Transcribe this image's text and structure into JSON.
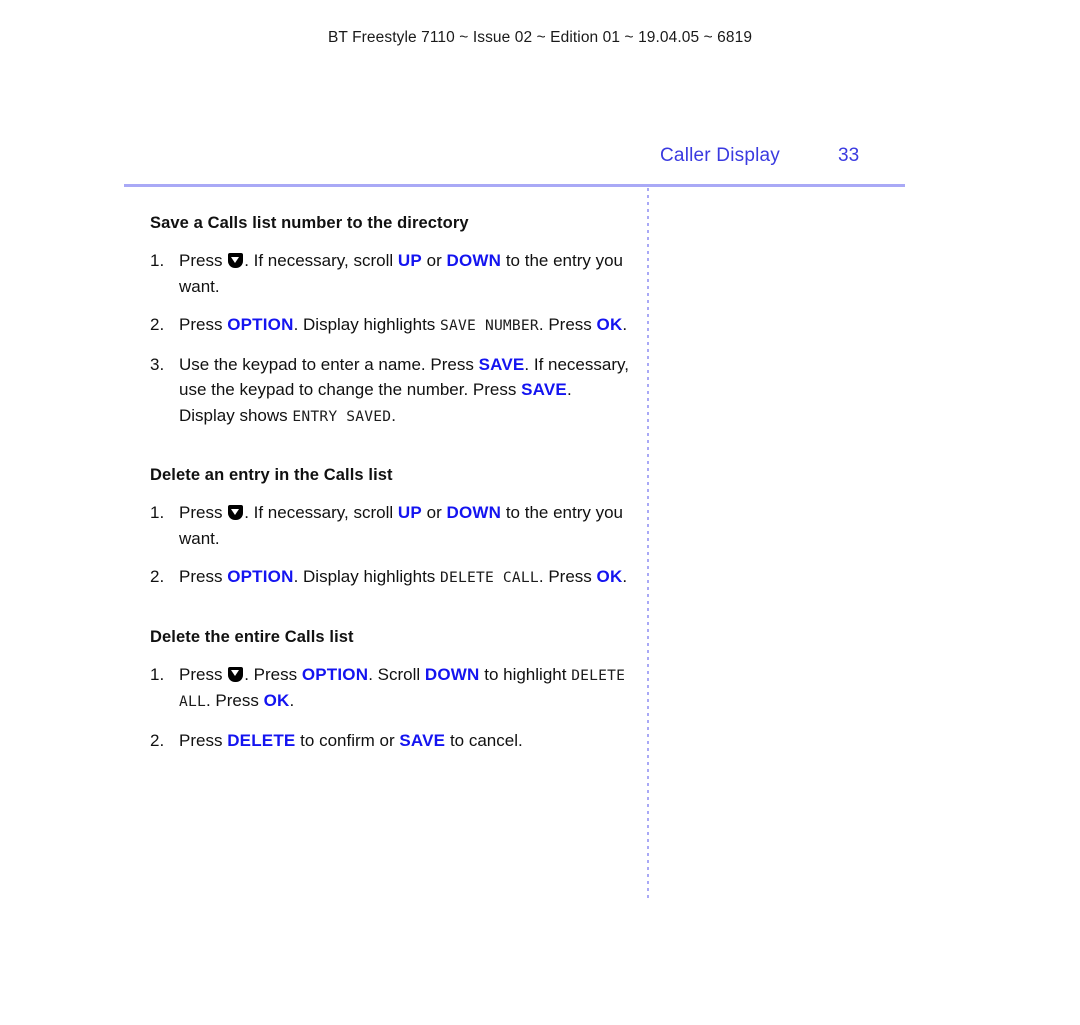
{
  "header": {
    "running_head": "BT Freestyle 7110 ~ Issue 02 ~ Edition 01 ~ 19.04.05 ~ 6819"
  },
  "chapter": {
    "title": "Caller Display",
    "page_number": "33"
  },
  "colors": {
    "keyword_blue": "#1414f0",
    "chapter_blue": "#3a3ae0",
    "rule_blue": "#a9a9f6",
    "body_black": "#111111"
  },
  "sections": [
    {
      "heading": "Save a Calls list number to the directory",
      "steps": [
        {
          "num": "1.",
          "parts": [
            {
              "type": "text",
              "text": "Press "
            },
            {
              "type": "icon",
              "name": "down-arrow-key-icon"
            },
            {
              "type": "text",
              "text": ". If necessary, scroll "
            },
            {
              "type": "kw",
              "text": "UP"
            },
            {
              "type": "text",
              "text": " or "
            },
            {
              "type": "kw",
              "text": "DOWN"
            },
            {
              "type": "text",
              "text": " to the entry you want."
            }
          ]
        },
        {
          "num": "2.",
          "parts": [
            {
              "type": "text",
              "text": "Press "
            },
            {
              "type": "kw",
              "text": "OPTION"
            },
            {
              "type": "text",
              "text": ". Display highlights "
            },
            {
              "type": "lcd",
              "text": "SAVE NUMBER"
            },
            {
              "type": "text",
              "text": ". Press "
            },
            {
              "type": "kw",
              "text": "OK"
            },
            {
              "type": "text",
              "text": "."
            }
          ]
        },
        {
          "num": "3.",
          "parts": [
            {
              "type": "text",
              "text": "Use the keypad to enter a name. Press "
            },
            {
              "type": "kw",
              "text": "SAVE"
            },
            {
              "type": "text",
              "text": ". If necessary, use the keypad to change the number. Press "
            },
            {
              "type": "kw",
              "text": "SAVE"
            },
            {
              "type": "text",
              "text": ". Display shows "
            },
            {
              "type": "lcd",
              "text": "ENTRY SAVED"
            },
            {
              "type": "text",
              "text": "."
            }
          ]
        }
      ]
    },
    {
      "heading": "Delete an entry in the Calls list",
      "steps": [
        {
          "num": "1.",
          "parts": [
            {
              "type": "text",
              "text": "Press "
            },
            {
              "type": "icon",
              "name": "down-arrow-key-icon"
            },
            {
              "type": "text",
              "text": ". If necessary, scroll "
            },
            {
              "type": "kw",
              "text": "UP"
            },
            {
              "type": "text",
              "text": " or "
            },
            {
              "type": "kw",
              "text": "DOWN"
            },
            {
              "type": "text",
              "text": " to the entry you want."
            }
          ]
        },
        {
          "num": "2.",
          "parts": [
            {
              "type": "text",
              "text": "Press "
            },
            {
              "type": "kw",
              "text": "OPTION"
            },
            {
              "type": "text",
              "text": ". Display highlights "
            },
            {
              "type": "lcd",
              "text": "DELETE CALL"
            },
            {
              "type": "text",
              "text": ". Press "
            },
            {
              "type": "kw",
              "text": "OK"
            },
            {
              "type": "text",
              "text": "."
            }
          ]
        }
      ]
    },
    {
      "heading": "Delete the entire Calls list",
      "steps": [
        {
          "num": "1.",
          "parts": [
            {
              "type": "text",
              "text": "Press "
            },
            {
              "type": "icon",
              "name": "down-arrow-key-icon"
            },
            {
              "type": "text",
              "text": ". Press "
            },
            {
              "type": "kw",
              "text": "OPTION"
            },
            {
              "type": "text",
              "text": ". Scroll "
            },
            {
              "type": "kw",
              "text": "DOWN"
            },
            {
              "type": "text",
              "text": " to highlight "
            },
            {
              "type": "lcd",
              "text": "DELETE ALL"
            },
            {
              "type": "text",
              "text": ". Press "
            },
            {
              "type": "kw",
              "text": "OK"
            },
            {
              "type": "text",
              "text": "."
            }
          ]
        },
        {
          "num": "2.",
          "parts": [
            {
              "type": "text",
              "text": "Press "
            },
            {
              "type": "kw",
              "text": "DELETE"
            },
            {
              "type": "text",
              "text": " to confirm or "
            },
            {
              "type": "kw",
              "text": "SAVE"
            },
            {
              "type": "text",
              "text": " to cancel."
            }
          ]
        }
      ]
    }
  ]
}
